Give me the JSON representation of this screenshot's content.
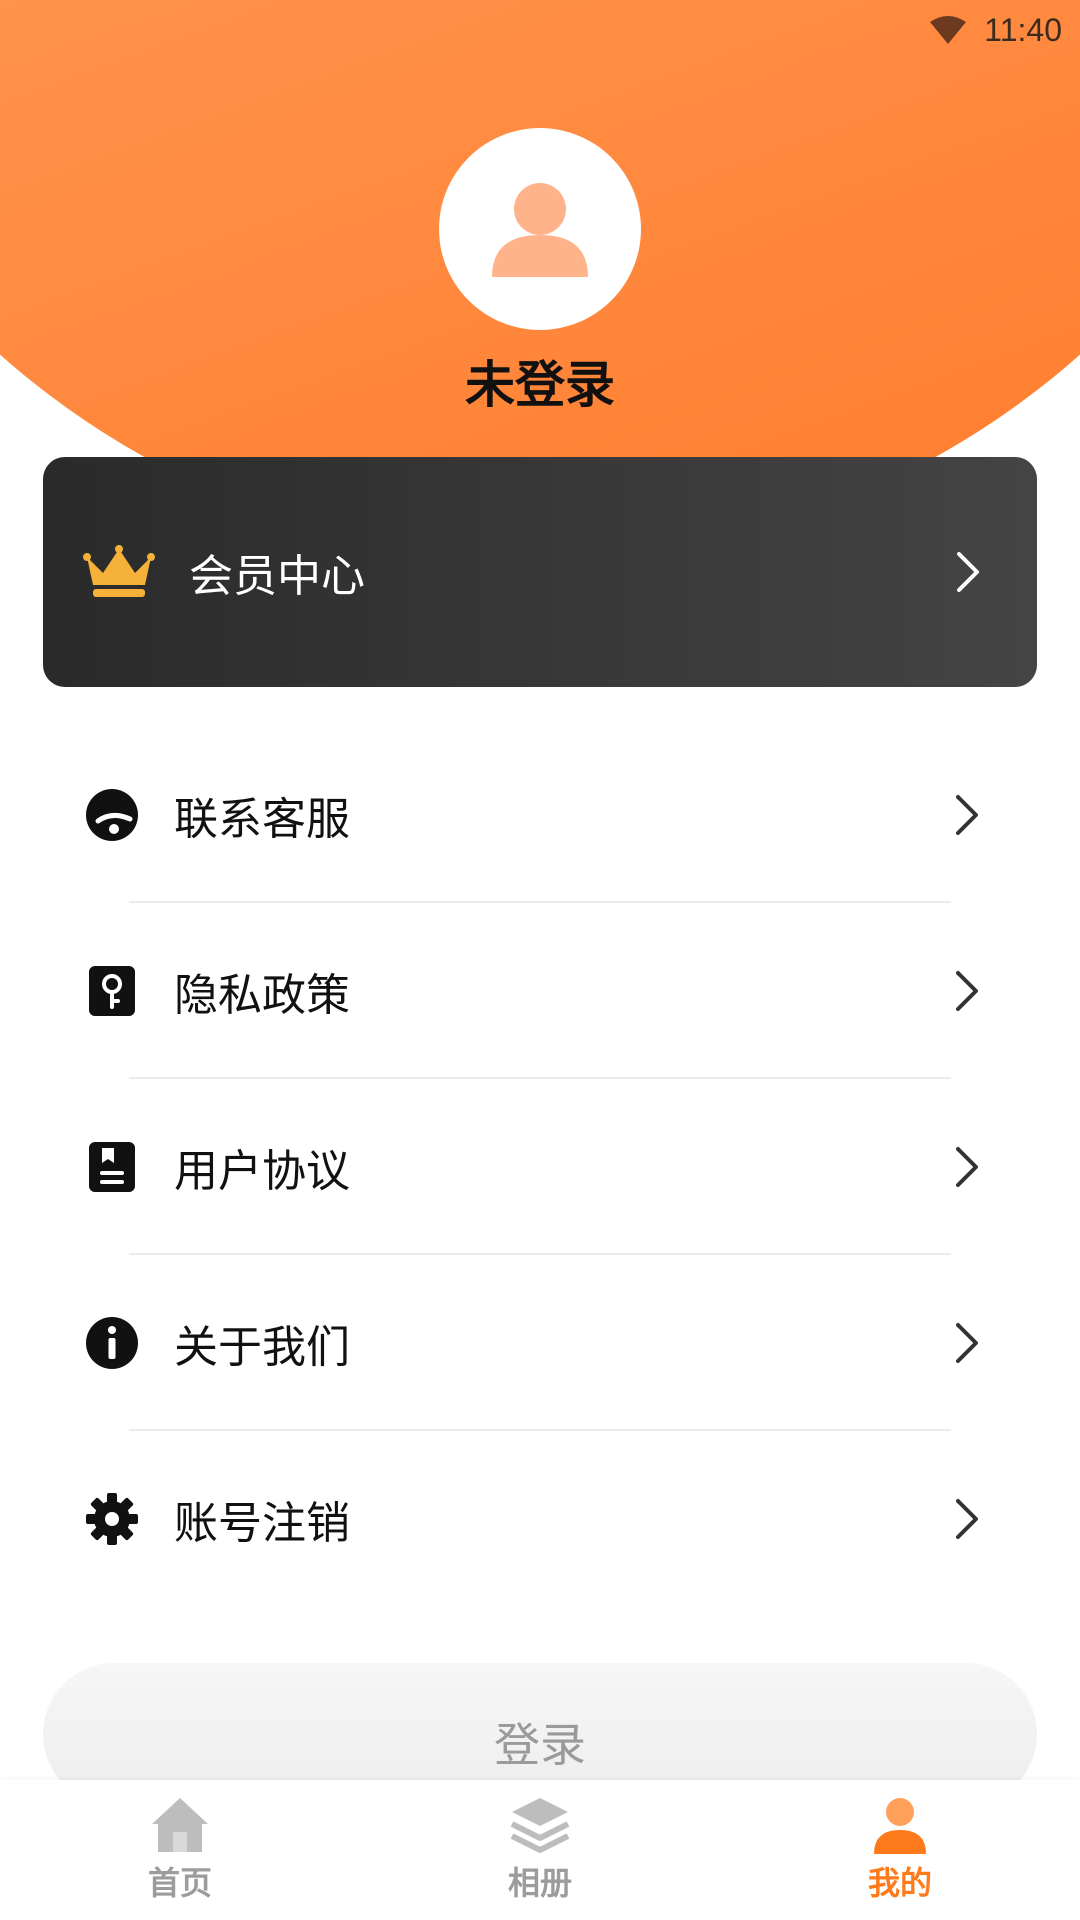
{
  "status_bar": {
    "time": "11:40"
  },
  "profile": {
    "name": "未登录"
  },
  "vip_card": {
    "label": "会员中心"
  },
  "menu": [
    {
      "label": "联系客服",
      "icon": "customer-service-icon"
    },
    {
      "label": "隐私政策",
      "icon": "privacy-key-icon"
    },
    {
      "label": "用户协议",
      "icon": "agreement-book-icon"
    },
    {
      "label": "关于我们",
      "icon": "info-icon"
    },
    {
      "label": "账号注销",
      "icon": "gear-icon"
    }
  ],
  "login_button": {
    "label": "登录"
  },
  "tabs": [
    {
      "label": "首页",
      "icon": "home-icon",
      "active": false
    },
    {
      "label": "相册",
      "icon": "layers-icon",
      "active": false
    },
    {
      "label": "我的",
      "icon": "person-icon",
      "active": true
    }
  ],
  "colors": {
    "accent": "#ff7a1a",
    "header_gradient_start": "#ffb07d",
    "header_gradient_end": "#ff7a2a",
    "vip_card": "#333333",
    "crown": "#f5b13a",
    "inactive_tab": "#9c9c9c"
  }
}
